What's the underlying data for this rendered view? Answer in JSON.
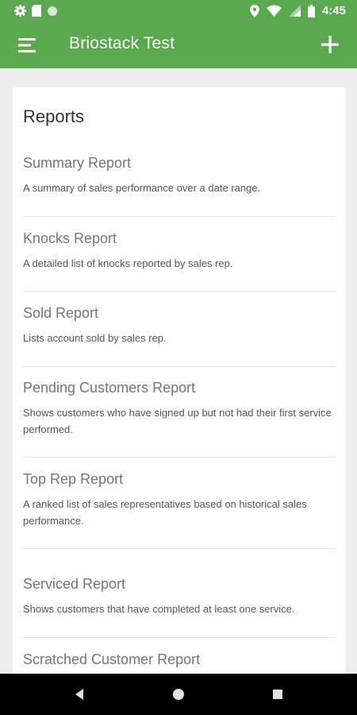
{
  "status_bar": {
    "time": "4:45",
    "icons": [
      "settings-icon",
      "sd-card-icon",
      "circle-icon",
      "location-icon",
      "wifi-icon",
      "signal-icon",
      "battery-icon"
    ]
  },
  "app_bar": {
    "title": "Briostack Test",
    "menu_icon": "menu-icon",
    "add_icon": "add-icon",
    "color": "#5aa94f"
  },
  "reports": {
    "heading": "Reports",
    "items": [
      {
        "title": "Summary Report",
        "description": "A summary of sales performance over a date range."
      },
      {
        "title": "Knocks Report",
        "description": "A detailed list of knocks reported by sales rep."
      },
      {
        "title": "Sold Report",
        "description": "Lists account sold by sales rep."
      },
      {
        "title": "Pending Customers Report",
        "description": "Shows customers who have signed up but not had their first service performed."
      },
      {
        "title": "Top Rep Report",
        "description": "A ranked list of sales representatives based on historical sales performance."
      },
      {
        "title": "Serviced Report",
        "description": "Shows customers that have completed at least one service."
      },
      {
        "title": "Scratched Customer Report",
        "description": ""
      }
    ]
  },
  "nav_bar": {
    "icons": [
      "back-icon",
      "home-icon",
      "recents-icon"
    ]
  }
}
